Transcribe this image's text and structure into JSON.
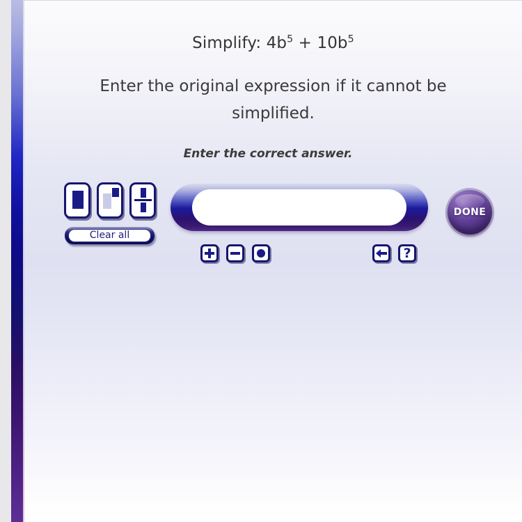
{
  "problem": {
    "label": "Simplify:",
    "expression_prefix": "4b",
    "expression_exp1": "5",
    "expression_operator": " + 10b",
    "expression_exp2": "5",
    "full_text": "Simplify: 4b^5 + 10b^5"
  },
  "instruction": {
    "text": "Enter the original expression if it cannot be simplified."
  },
  "prompt": {
    "text": "Enter the correct answer."
  },
  "palette": {
    "templates": [
      {
        "name": "box-template",
        "tooltip": "Box"
      },
      {
        "name": "exponent-template",
        "tooltip": "Exponent"
      },
      {
        "name": "fraction-template",
        "tooltip": "Fraction"
      }
    ],
    "clear_all_label": "Clear all"
  },
  "answer_input": {
    "value": "",
    "placeholder": ""
  },
  "operators": {
    "left": [
      {
        "name": "plus-button",
        "glyph": "+"
      },
      {
        "name": "minus-button",
        "glyph": "−"
      },
      {
        "name": "multiply-dot-button",
        "glyph": "•"
      }
    ],
    "right": [
      {
        "name": "backspace-button",
        "glyph": "←"
      },
      {
        "name": "help-button",
        "glyph": "?"
      }
    ]
  },
  "done_button": {
    "label": "DONE"
  },
  "colors": {
    "accent_navy": "#16166e",
    "accent_blue": "#1b1b86",
    "done_purple": "#5f3f96",
    "text_dark": "#363636"
  }
}
